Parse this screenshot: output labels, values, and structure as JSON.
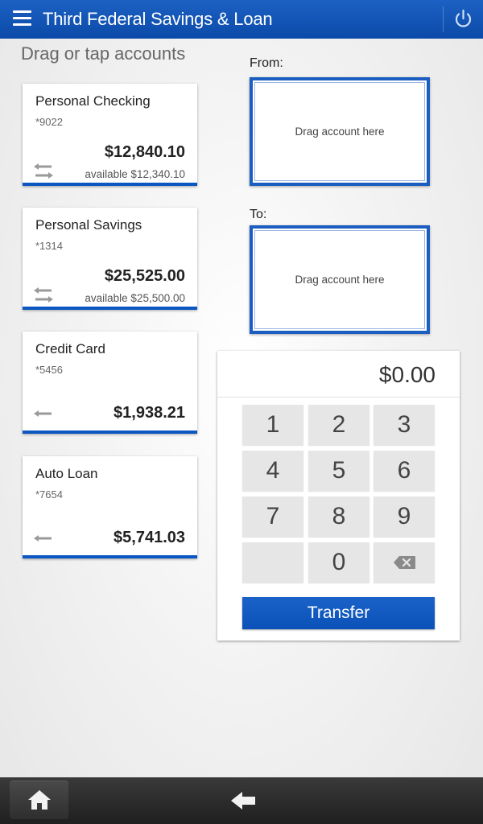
{
  "header": {
    "title": "Third Federal Savings & Loan",
    "menu_icon": "hamburger-menu-icon",
    "power_icon": "power-icon"
  },
  "instruction": "Drag or tap accounts",
  "accounts": [
    {
      "name": "Personal Checking",
      "number": "*9022",
      "balance": "$12,840.10",
      "available": "available $12,340.10",
      "icon": "transfer-both-ways-icon"
    },
    {
      "name": "Personal Savings",
      "number": "*1314",
      "balance": "$25,525.00",
      "available": "available $25,500.00",
      "icon": "transfer-both-ways-icon"
    },
    {
      "name": "Credit Card",
      "number": "*5456",
      "balance": "$1,938.21",
      "icon": "transfer-in-icon"
    },
    {
      "name": "Auto Loan",
      "number": "*7654",
      "balance": "$5,741.03",
      "icon": "transfer-in-icon"
    }
  ],
  "from": {
    "label": "From:",
    "placeholder": "Drag account here"
  },
  "to": {
    "label": "To:",
    "placeholder": "Drag account here"
  },
  "keypad": {
    "amount": "$0.00",
    "keys": [
      "1",
      "2",
      "3",
      "4",
      "5",
      "6",
      "7",
      "8",
      "9",
      "",
      "0"
    ],
    "backspace_icon": "backspace-icon",
    "transfer_label": "Transfer"
  },
  "nav": {
    "home_icon": "home-icon",
    "back_icon": "back-arrow-icon"
  },
  "colors": {
    "brand_blue": "#0b56c1",
    "header_blue": "#1c61c4",
    "nav_dark": "#2a2a2a"
  }
}
